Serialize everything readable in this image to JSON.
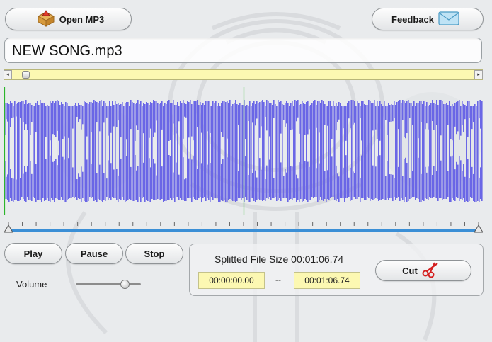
{
  "toolbar": {
    "open_label": "Open MP3",
    "feedback_label": "Feedback"
  },
  "file": {
    "name": "NEW SONG.mp3"
  },
  "scrollbar": {
    "left_arrow": "◂",
    "right_arrow": "▸",
    "position": 0.02
  },
  "waveform": {
    "color": "#6a66e6",
    "marker_color": "#2bb52b",
    "marker_positions": [
      0.0,
      0.5
    ]
  },
  "timeline": {
    "track_color": "#3b8fd6",
    "tick_count": 34,
    "selection_start": 0.0,
    "selection_end": 1.0
  },
  "controls": {
    "play_label": "Play",
    "pause_label": "Pause",
    "stop_label": "Stop",
    "volume_label": "Volume",
    "volume_level": 0.75
  },
  "split": {
    "size_label": "Splitted File Size 00:01:06.74",
    "start_time": "00:00:00.00",
    "separator": "--",
    "end_time": "00:01:06.74",
    "cut_label": "Cut"
  },
  "icons": {
    "open": "open-folder-icon",
    "feedback": "envelope-icon",
    "cut": "scissors-icon"
  },
  "colors": {
    "field_yellow": "#fcf8b2",
    "background": "#e9ebed"
  }
}
